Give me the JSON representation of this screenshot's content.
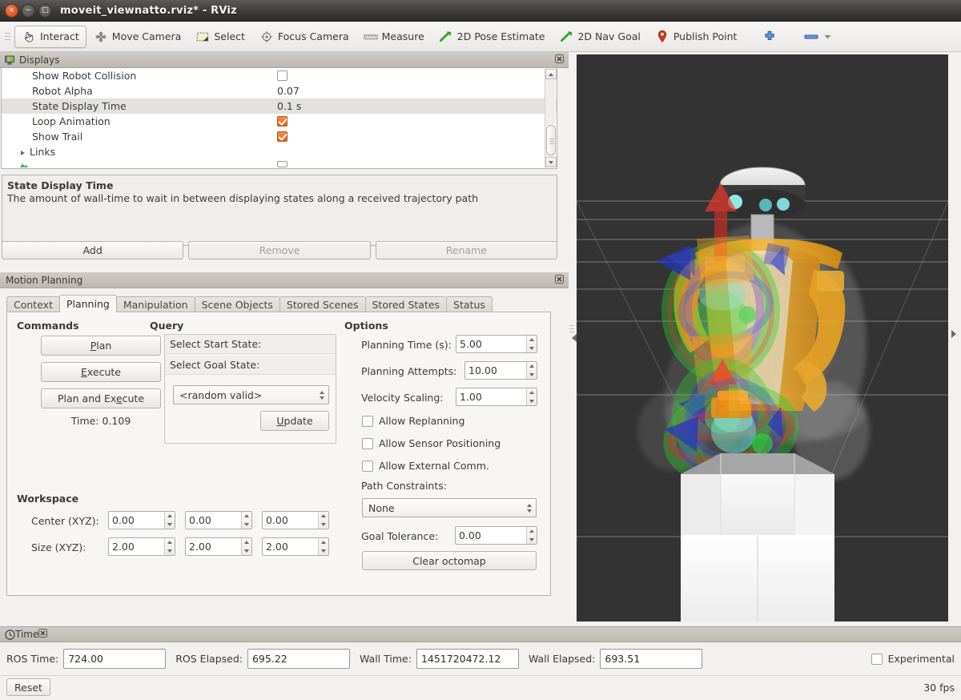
{
  "window": {
    "title": "moveit_viewnatto.rviz* - RViz",
    "buttons": {
      "close": "×",
      "minimize": "−",
      "maximize": "□"
    }
  },
  "toolbar": {
    "items": [
      {
        "label": "Interact",
        "icon": "hand-cursor-icon",
        "checked": true
      },
      {
        "label": "Move Camera",
        "icon": "move-camera-icon",
        "checked": false
      },
      {
        "label": "Select",
        "icon": "select-rect-icon",
        "checked": false
      },
      {
        "label": "Focus Camera",
        "icon": "focus-camera-icon",
        "checked": false
      },
      {
        "label": "Measure",
        "icon": "ruler-icon",
        "checked": false
      },
      {
        "label": "2D Pose Estimate",
        "icon": "pose-arrow-icon",
        "checked": false
      },
      {
        "label": "2D Nav Goal",
        "icon": "nav-goal-arrow-icon",
        "checked": false
      },
      {
        "label": "Publish Point",
        "icon": "map-pin-icon",
        "checked": false
      }
    ],
    "add_tool_icon": "plus-icon",
    "remove_tool_icon": "minus-icon",
    "remove_tool_menu_icon": "chevron-down-icon"
  },
  "displays_panel": {
    "title": "Displays",
    "icon": "monitor-icon",
    "close_icon": "close-icon",
    "rows": [
      {
        "name": "Show Robot Collision",
        "value": "",
        "type": "checkbox",
        "checked": false,
        "selected": false,
        "expandable": false
      },
      {
        "name": "Robot Alpha",
        "value": "0.07",
        "type": "text",
        "selected": false,
        "expandable": false
      },
      {
        "name": "State Display Time",
        "value": "0.1 s",
        "type": "text",
        "selected": true,
        "expandable": false
      },
      {
        "name": "Loop Animation",
        "value": "",
        "type": "checkbox",
        "checked": true,
        "selected": false,
        "expandable": false
      },
      {
        "name": "Show Trail",
        "value": "",
        "type": "checkbox",
        "checked": true,
        "selected": false,
        "expandable": false
      },
      {
        "name": "Links",
        "value": "",
        "type": "none",
        "selected": false,
        "expandable": true
      }
    ],
    "description": {
      "title": "State Display Time",
      "text": "The amount of wall-time to wait in between displaying states along a received trajectory path"
    },
    "buttons": [
      {
        "label": "Add",
        "enabled": true
      },
      {
        "label": "Remove",
        "enabled": false
      },
      {
        "label": "Rename",
        "enabled": false
      }
    ]
  },
  "motion_planning": {
    "title": "Motion Planning",
    "close_icon": "close-icon",
    "tabs": [
      {
        "label": "Context",
        "active": false
      },
      {
        "label": "Planning",
        "active": true
      },
      {
        "label": "Manipulation",
        "active": false
      },
      {
        "label": "Scene Objects",
        "active": false
      },
      {
        "label": "Stored Scenes",
        "active": false
      },
      {
        "label": "Stored States",
        "active": false
      },
      {
        "label": "Status",
        "active": false
      }
    ],
    "commands": {
      "heading": "Commands",
      "buttons": [
        {
          "pre": "",
          "mn": "P",
          "post": "lan"
        },
        {
          "pre": "",
          "mn": "E",
          "post": "xecute"
        },
        {
          "pre": "Plan and Ex",
          "mn": "e",
          "post": "cute"
        }
      ],
      "time_label": "Time: 0.109"
    },
    "query": {
      "heading": "Query",
      "start_state_label": "Select Start State:",
      "goal_state_label": "Select Goal State:",
      "goal_state_value": "<random valid>",
      "update_button": {
        "pre": "",
        "mn": "U",
        "post": "pdate"
      }
    },
    "options": {
      "heading": "Options",
      "planning_time_label": "Planning Time (s):",
      "planning_time_value": "5.00",
      "planning_attempts_label": "Planning Attempts:",
      "planning_attempts_value": "10.00",
      "velocity_scaling_label": "Velocity Scaling:",
      "velocity_scaling_value": "1.00",
      "checkboxes": [
        {
          "label": "Allow Replanning",
          "checked": false
        },
        {
          "label": "Allow Sensor Positioning",
          "checked": false
        },
        {
          "label": "Allow External Comm.",
          "checked": false
        }
      ],
      "path_constraints_label": "Path Constraints:",
      "path_constraints_value": "None",
      "goal_tolerance_label": "Goal Tolerance:",
      "goal_tolerance_value": "0.00",
      "clear_octomap_label": "Clear octomap"
    },
    "workspace": {
      "heading": "Workspace",
      "center_label": "Center (XYZ):",
      "center_values": [
        "0.00",
        "0.00",
        "0.00"
      ],
      "size_label": "Size (XYZ):",
      "size_values": [
        "2.00",
        "2.00",
        "2.00"
      ]
    }
  },
  "view3d": {
    "name": "rviz-3d-render-view",
    "background_color": "#333333",
    "grid_color": "#8d8d8d",
    "collapse_left_icon": "collapse-left-arrow-icon",
    "collapse_right_icon": "collapse-right-arrow-icon"
  },
  "time_panel": {
    "title": "Time",
    "icon": "clock-icon",
    "close_icon": "close-icon",
    "fields": [
      {
        "label": "ROS Time:",
        "value": "724.00"
      },
      {
        "label": "ROS Elapsed:",
        "value": "695.22"
      },
      {
        "label": "Wall Time:",
        "value": "1451720472.12"
      },
      {
        "label": "Wall Elapsed:",
        "value": "693.51"
      }
    ],
    "experimental_label": "Experimental",
    "experimental_checked": false,
    "reset_label": "Reset",
    "fps_label": "30 fps"
  },
  "colors": {
    "accent_orange": "#e2661b",
    "panel_bg": "#f2f1f0",
    "header_bg": "#bdb8b2",
    "titlebar_bg": "#3c3b39",
    "view_bg": "#333333"
  }
}
